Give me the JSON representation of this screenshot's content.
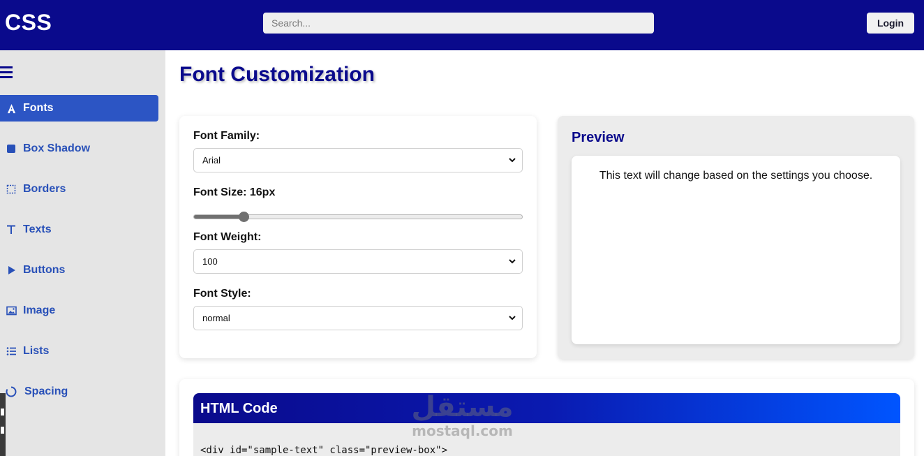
{
  "header": {
    "logo": "CSS",
    "search_placeholder": "Search...",
    "login_label": "Login"
  },
  "sidebar": {
    "items": [
      {
        "label": "Fonts",
        "icon": "font-icon",
        "active": true
      },
      {
        "label": "Box Shadow",
        "icon": "square-icon",
        "active": false
      },
      {
        "label": "Borders",
        "icon": "border-icon",
        "active": false
      },
      {
        "label": "Texts",
        "icon": "text-icon",
        "active": false
      },
      {
        "label": "Buttons",
        "icon": "play-icon",
        "active": false
      },
      {
        "label": "Image",
        "icon": "image-icon",
        "active": false
      },
      {
        "label": "Lists",
        "icon": "list-icon",
        "active": false
      },
      {
        "label": "Spacing",
        "icon": "circle-notch-icon",
        "active": false
      }
    ]
  },
  "main": {
    "title": "Font Customization",
    "controls": {
      "font_family_label": "Font Family:",
      "font_family_value": "Arial",
      "font_size_label": "Font Size: 16px",
      "font_size_slider_fraction": 0.15,
      "font_weight_label": "Font Weight:",
      "font_weight_value": "100",
      "font_style_label": "Font Style:",
      "font_style_value": "normal"
    },
    "preview": {
      "title": "Preview",
      "text": "This text will change based on the settings you choose."
    },
    "code": {
      "title": "HTML Code",
      "line": "<div id=\"sample-text\" class=\"preview-box\">"
    }
  },
  "watermark": {
    "arabic": "مستقل",
    "latin": "mostaql.com"
  },
  "colors": {
    "header_bg": "#0a0a8c",
    "accent": "#2c55c4",
    "nav_text": "#2850b8",
    "sidebar_bg": "#e5e5e5"
  }
}
